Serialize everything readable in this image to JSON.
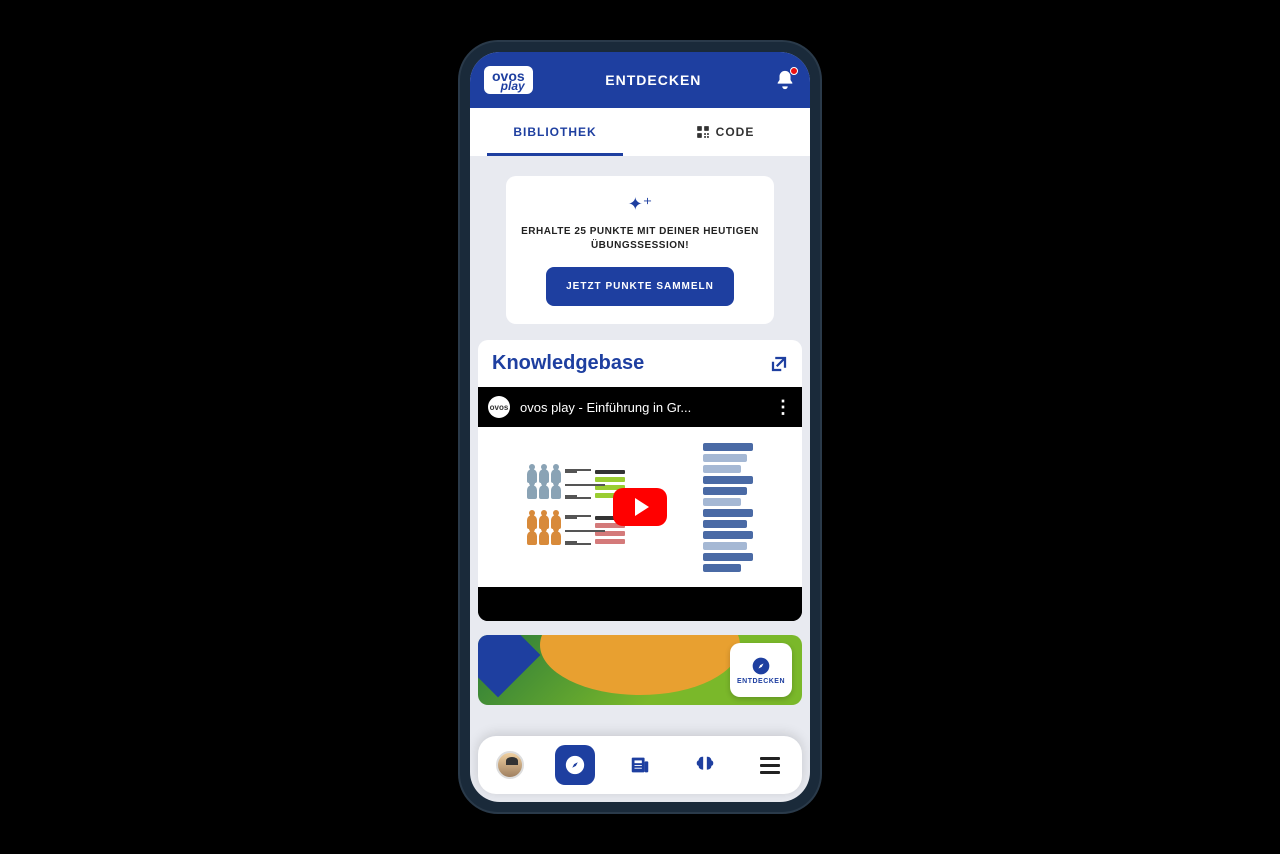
{
  "header": {
    "logo_l1": "ovos",
    "logo_l2": "play",
    "title": "ENTDECKEN"
  },
  "tabs": {
    "library": "BIBLIOTHEK",
    "code": "CODE"
  },
  "points_card": {
    "prefix": "ERHALTE ",
    "bold": "25 PUNKTE",
    "suffix": " MIT DEINER HEUTIGEN ÜBUNGSSESSION!",
    "button": "JETZT PUNKTE SAMMELN"
  },
  "knowledgebase": {
    "title": "Knowledgebase",
    "video_channel": "ovos",
    "video_title": "ovos play - Einführung in Gr..."
  },
  "fab_label": "ENTDECKEN",
  "colors": {
    "primary": "#1e3fa0"
  }
}
